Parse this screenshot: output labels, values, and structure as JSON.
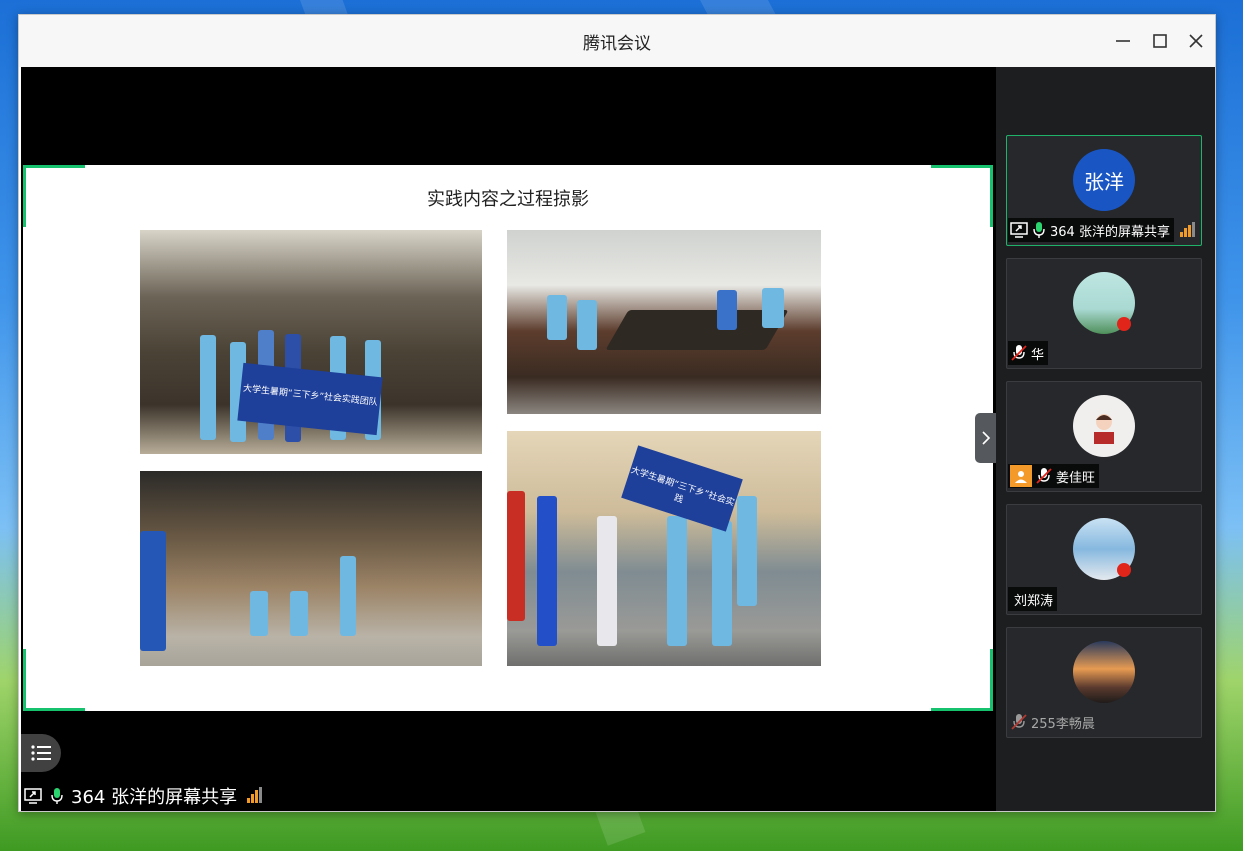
{
  "window": {
    "title": "腾讯会议"
  },
  "slide": {
    "title": "实践内容之过程掠影"
  },
  "photos": [
    {
      "caption": "大学生暑期“三下乡”社会实践团队"
    },
    {
      "caption": ""
    },
    {
      "caption": ""
    },
    {
      "caption": "大学生暑期“三下乡”社会实践"
    }
  ],
  "share_bar": {
    "label": "364 张洋的屏幕共享"
  },
  "participants": [
    {
      "avatar_text": "张洋",
      "name": "364 张洋的屏幕共享",
      "state": "sharing-mic-on",
      "active": true
    },
    {
      "avatar_text": "",
      "name": "华",
      "state": "mic-muted",
      "active": false
    },
    {
      "avatar_text": "",
      "name": "姜佳旺",
      "state": "host-mic-muted",
      "active": false
    },
    {
      "avatar_text": "",
      "name": "刘郑涛",
      "state": "no-mic",
      "active": false
    },
    {
      "avatar_text": "",
      "name": "255李畅晨",
      "state": "mic-muted-dim",
      "active": false
    }
  ],
  "colors": {
    "accent_green": "#16c26e",
    "share_orange": "#f29b26",
    "avatar_blue": "#1956c4"
  }
}
